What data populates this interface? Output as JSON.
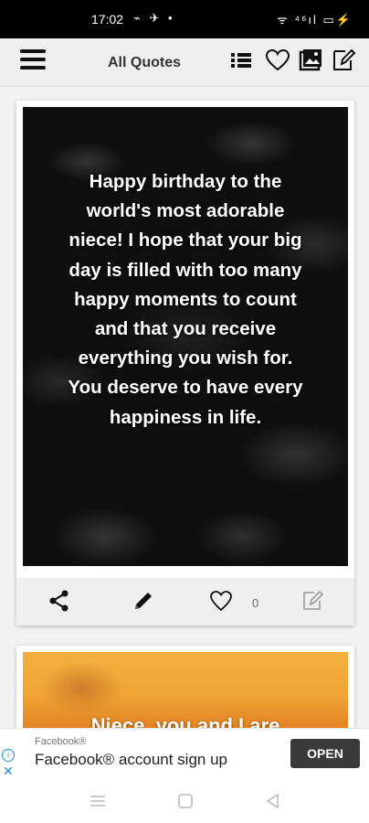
{
  "status_bar": {
    "time": "17:02",
    "left_icons": "⌁ ✈ •",
    "right_icons": "ᯤ ⁴⁶ıl ▭⚡"
  },
  "app_bar": {
    "title": "All Quotes",
    "icons": [
      "menu-icon",
      "list-icon",
      "heart-icon",
      "gallery-icon",
      "edit-icon"
    ]
  },
  "cards": [
    {
      "quote": "Happy birthday to the world's most adorable niece! I hope that your big day is filled with too many happy moments to count and that you receive everything you wish for. You deserve to have every happiness in life.",
      "like_count": "0"
    },
    {
      "quote_partial": "Niece, you and I are"
    }
  ],
  "ad": {
    "advertiser": "Facebook®",
    "headline": "Facebook® account sign up",
    "cta": "OPEN"
  },
  "colors": {
    "status_bar": "#000000",
    "app_bar": "#efefef",
    "card_action_bar": "#efefef",
    "ad_cta": "#3a3a3a",
    "ad_icon": "#1a8fd6"
  }
}
